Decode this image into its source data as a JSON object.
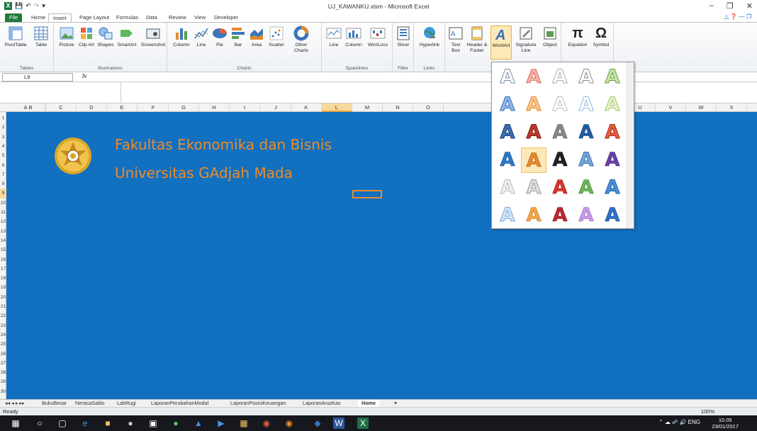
{
  "window": {
    "title": "UJ_KAWANKU.xlsm - Microsoft Excel"
  },
  "tabs": [
    "File",
    "Home",
    "Insert",
    "Page Layout",
    "Formulas",
    "Data",
    "Review",
    "View",
    "Developer"
  ],
  "ribbon": {
    "groups": [
      {
        "label": "Tables",
        "buttons": [
          "PivotTable",
          "Table"
        ]
      },
      {
        "label": "Illustrations",
        "buttons": [
          "Picture",
          "Clip Art",
          "Shapes",
          "SmartArt",
          "Screenshot"
        ]
      },
      {
        "label": "Charts",
        "buttons": [
          "Column",
          "Line",
          "Pie",
          "Bar",
          "Area",
          "Scatter",
          "Other Charts"
        ]
      },
      {
        "label": "Sparklines",
        "buttons": [
          "Line",
          "Column",
          "Win/Loss"
        ]
      },
      {
        "label": "Filter",
        "buttons": [
          "Slicer"
        ]
      },
      {
        "label": "Links",
        "buttons": [
          "Hyperlink"
        ]
      },
      {
        "label": "",
        "buttons": [
          "Text Box",
          "Header & Footer",
          "WordArt",
          "Signature Line",
          "Object"
        ]
      },
      {
        "label": "",
        "buttons": [
          "Equation",
          "Symbol"
        ]
      }
    ]
  },
  "formula_bar": {
    "name_box": "L9",
    "fx": "fx",
    "value": ""
  },
  "columns": [
    "A",
    "B",
    "C",
    "D",
    "E",
    "F",
    "G",
    "H",
    "I",
    "J",
    "K",
    "L",
    "M",
    "N",
    "O",
    "P",
    "U",
    "V",
    "W",
    "X"
  ],
  "rows": [
    "1",
    "2",
    "3",
    "4",
    "5",
    "6",
    "7",
    "8",
    "9",
    "10",
    "11",
    "12",
    "13",
    "14",
    "15",
    "16",
    "17",
    "18",
    "19",
    "20",
    "21",
    "22",
    "23",
    "24",
    "25",
    "26",
    "27",
    "28",
    "29",
    "30"
  ],
  "sheet": {
    "line1": "Fakultas Ekonomika dan Bisnis",
    "line2": "Universitas GAdjah Mada",
    "bg_color": "#1170c0",
    "text_color": "#f08a24"
  },
  "wordart_gallery": {
    "glyph": "A",
    "rows": 6,
    "cols": 5,
    "highlighted": [
      3,
      1
    ]
  },
  "sheet_tabs": [
    "BukuBesar",
    "NeracaSaldo",
    "LabRugi",
    "LaporanPerubahanModal",
    "LaporanPosisiKeuangan",
    "LaporanArusKas",
    "Home"
  ],
  "active_sheet": "Home",
  "status": {
    "ready": "Ready",
    "zoom": "100%"
  },
  "taskbar": {
    "lang": "ENG",
    "time": "10.05",
    "date": "23/01/2017"
  }
}
